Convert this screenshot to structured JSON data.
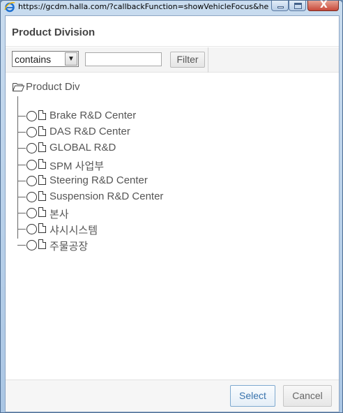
{
  "window": {
    "url": "https://gcdm.halla.com/?callbackFunction=showVehicleFocus&he..."
  },
  "dialog": {
    "title": "Product Division"
  },
  "filter": {
    "operator_selected": "contains",
    "input_value": "",
    "button_label": "Filter"
  },
  "tree": {
    "root_label": "Product Div",
    "items": [
      {
        "label": "Brake R&D Center"
      },
      {
        "label": "DAS R&D Center"
      },
      {
        "label": "GLOBAL R&D"
      },
      {
        "label": "SPM 사업부"
      },
      {
        "label": "Steering R&D Center"
      },
      {
        "label": "Suspension R&D Center"
      },
      {
        "label": "본사"
      },
      {
        "label": "샤시시스템"
      },
      {
        "label": "주물공장"
      }
    ]
  },
  "footer": {
    "select_label": "Select",
    "cancel_label": "Cancel"
  },
  "icons": {
    "browser": "ie-icon",
    "root": "folder-open-icon",
    "node": "document-icon"
  }
}
